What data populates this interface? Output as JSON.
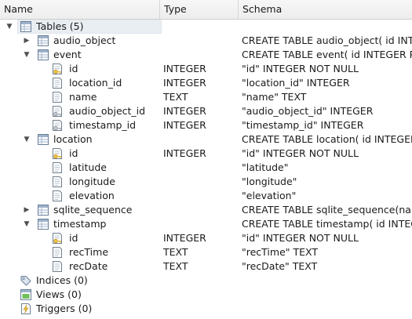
{
  "header": {
    "name": "Name",
    "type": "Type",
    "schema": "Schema"
  },
  "rows": [
    {
      "label": "Tables (5)",
      "type": "",
      "schema": ""
    },
    {
      "label": "audio_object",
      "type": "",
      "schema": "CREATE TABLE audio_object( id INTEGER"
    },
    {
      "label": "event",
      "type": "",
      "schema": "CREATE TABLE event( id INTEGER PRIMARY"
    },
    {
      "label": "id",
      "type": "INTEGER",
      "schema": "\"id\" INTEGER NOT NULL"
    },
    {
      "label": "location_id",
      "type": "INTEGER",
      "schema": "\"location_id\" INTEGER"
    },
    {
      "label": "name",
      "type": "TEXT",
      "schema": "\"name\" TEXT"
    },
    {
      "label": "audio_object_id",
      "type": "INTEGER",
      "schema": "\"audio_object_id\" INTEGER"
    },
    {
      "label": "timestamp_id",
      "type": "INTEGER",
      "schema": "\"timestamp_id\" INTEGER"
    },
    {
      "label": "location",
      "type": "",
      "schema": "CREATE TABLE location( id INTEGER PRIMARY"
    },
    {
      "label": "id",
      "type": "INTEGER",
      "schema": "\"id\" INTEGER NOT NULL"
    },
    {
      "label": "latitude",
      "type": "",
      "schema": "\"latitude\""
    },
    {
      "label": "longitude",
      "type": "",
      "schema": "\"longitude\""
    },
    {
      "label": "elevation",
      "type": "",
      "schema": "\"elevation\""
    },
    {
      "label": "sqlite_sequence",
      "type": "",
      "schema": "CREATE TABLE sqlite_sequence(name,seq)"
    },
    {
      "label": "timestamp",
      "type": "",
      "schema": "CREATE TABLE timestamp( id INTEGER PRIM"
    },
    {
      "label": "id",
      "type": "INTEGER",
      "schema": "\"id\" INTEGER NOT NULL"
    },
    {
      "label": "recTime",
      "type": "TEXT",
      "schema": "\"recTime\" TEXT"
    },
    {
      "label": "recDate",
      "type": "TEXT",
      "schema": "\"recDate\" TEXT"
    },
    {
      "label": "Indices (0)",
      "type": "",
      "schema": ""
    },
    {
      "label": "Views (0)",
      "type": "",
      "schema": ""
    },
    {
      "label": "Triggers (0)",
      "type": "",
      "schema": ""
    }
  ]
}
